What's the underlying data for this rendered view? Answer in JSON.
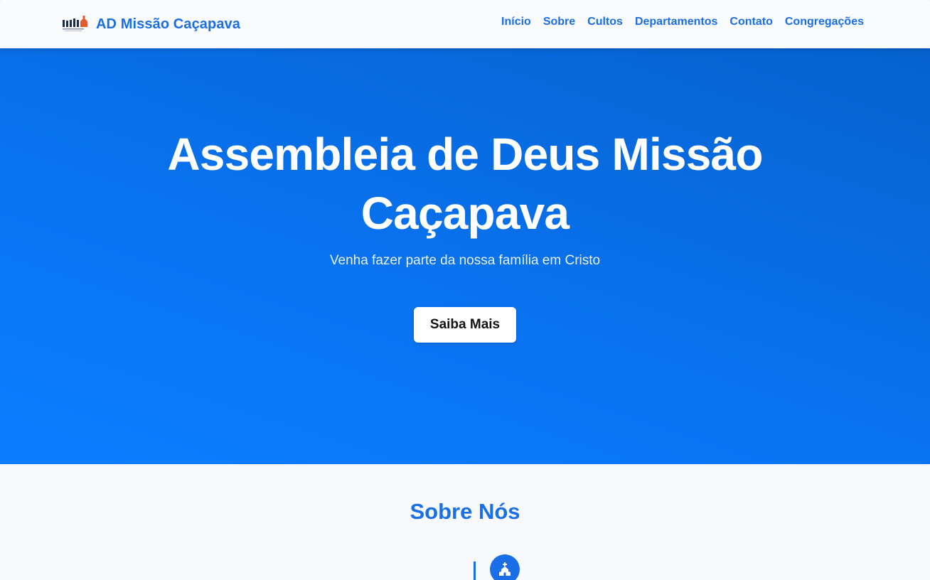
{
  "navbar": {
    "brand": "AD Missão Caçapava",
    "brand_logo_icon": "church-logo-icon",
    "links": [
      "Início",
      "Sobre",
      "Cultos",
      "Departamentos",
      "Contato",
      "Congregações"
    ]
  },
  "hero": {
    "title": "Assembleia de Deus Missão Caçapava",
    "subtitle": "Venha fazer parte da nossa família em Cristo",
    "button": "Saiba Mais"
  },
  "about": {
    "title": "Sobre Nós",
    "timeline_icon": "church-icon"
  },
  "colors": {
    "accent": "#1a6ee8",
    "hero_start": "#0a7eff",
    "hero_end": "#0562cf",
    "page_bg": "#f7f9fc"
  }
}
